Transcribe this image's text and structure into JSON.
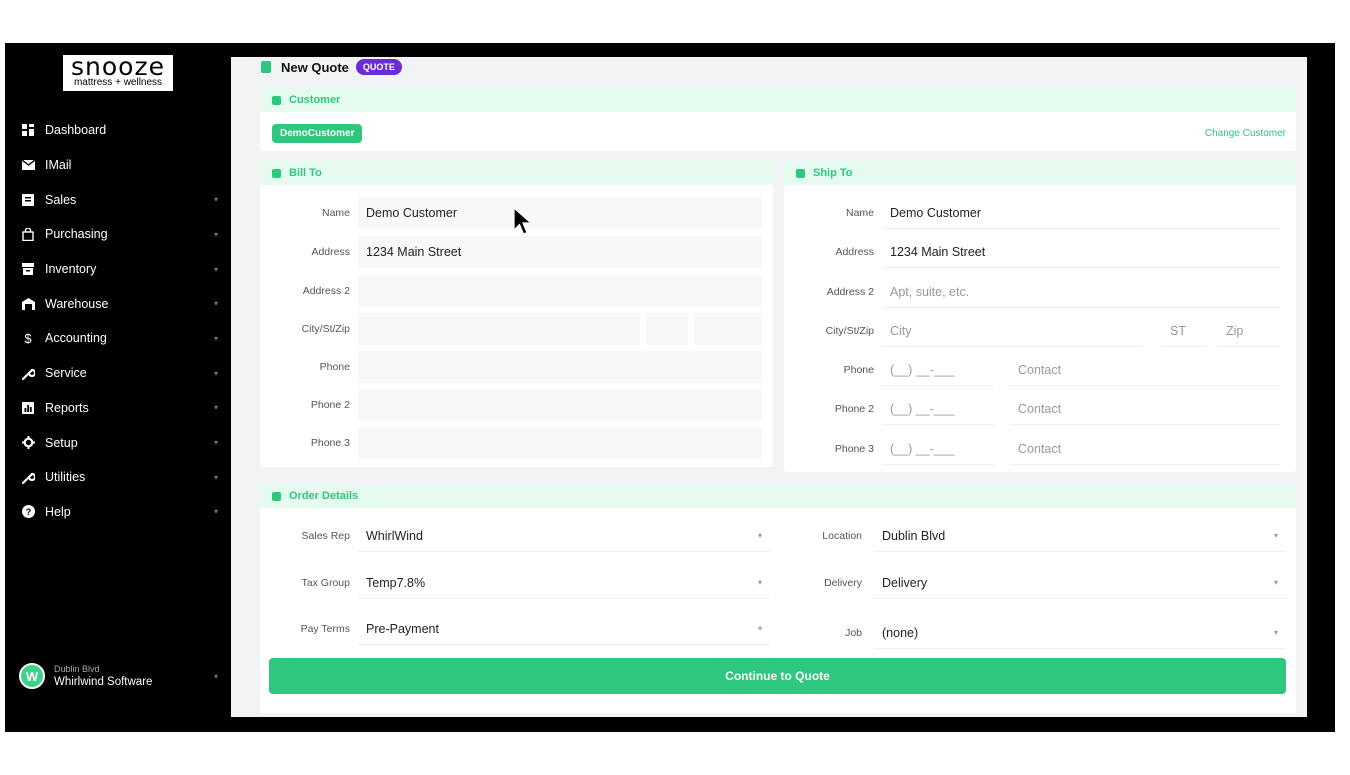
{
  "brand": {
    "logo_main": "snooze",
    "logo_sub": "mattress + wellness"
  },
  "sidebar": {
    "items": [
      {
        "label": "Dashboard",
        "icon": "dashboard-icon",
        "chevron": false
      },
      {
        "label": "IMail",
        "icon": "mail-icon",
        "chevron": false
      },
      {
        "label": "Sales",
        "icon": "sales-icon",
        "chevron": true
      },
      {
        "label": "Purchasing",
        "icon": "bag-icon",
        "chevron": true
      },
      {
        "label": "Inventory",
        "icon": "inventory-icon",
        "chevron": true
      },
      {
        "label": "Warehouse",
        "icon": "warehouse-icon",
        "chevron": true
      },
      {
        "label": "Accounting",
        "icon": "dollar-icon",
        "chevron": true
      },
      {
        "label": "Service",
        "icon": "wrench-icon",
        "chevron": true
      },
      {
        "label": "Reports",
        "icon": "reports-icon",
        "chevron": true
      },
      {
        "label": "Setup",
        "icon": "gear-icon",
        "chevron": true
      },
      {
        "label": "Utilities",
        "icon": "wrench-icon",
        "chevron": true
      },
      {
        "label": "Help",
        "icon": "help-icon",
        "chevron": true
      }
    ],
    "user": {
      "location": "Dublin Blvd",
      "name": "Whirlwind Software",
      "avatar_letter": "W"
    }
  },
  "page": {
    "title": "New Quote",
    "badge": "QUOTE"
  },
  "customer": {
    "header": "Customer",
    "selected": "DemoCustomer",
    "change_link": "Change Customer"
  },
  "bill_to": {
    "header": "Bill To",
    "labels": {
      "name": "Name",
      "address": "Address",
      "address2": "Address 2",
      "city": "City/St/Zip",
      "phone": "Phone",
      "phone2": "Phone 2",
      "phone3": "Phone 3"
    },
    "values": {
      "name": "Demo Customer",
      "address": "1234 Main Street",
      "address2": "",
      "city": "",
      "state": "",
      "zip": "",
      "phone": "",
      "phone2": "",
      "phone3": ""
    }
  },
  "ship_to": {
    "header": "Ship To",
    "labels": {
      "name": "Name",
      "address": "Address",
      "address2": "Address 2",
      "city": "City/St/Zip",
      "phone": "Phone",
      "phone2": "Phone 2",
      "phone3": "Phone 3"
    },
    "values": {
      "name": "Demo Customer",
      "address": "1234 Main Street"
    },
    "placeholders": {
      "address2": "Apt, suite, etc.",
      "city": "City",
      "state": "ST",
      "zip": "Zip",
      "phone": "(__) __-___",
      "contact": "Contact"
    }
  },
  "order": {
    "header": "Order Details",
    "labels": {
      "sales_rep": "Sales Rep",
      "tax_group": "Tax Group",
      "pay_terms": "Pay Terms",
      "location": "Location",
      "delivery": "Delivery",
      "job": "Job"
    },
    "values": {
      "sales_rep": "WhirlWind",
      "tax_group": "Temp7.8%",
      "pay_terms": "Pre-Payment",
      "location": "Dublin Blvd",
      "delivery": "Delivery",
      "job": "(none)"
    }
  },
  "actions": {
    "continue": "Continue to Quote"
  },
  "colors": {
    "accent": "#2dc77e",
    "badge": "#6b2bd9",
    "sidebar": "#000000"
  }
}
